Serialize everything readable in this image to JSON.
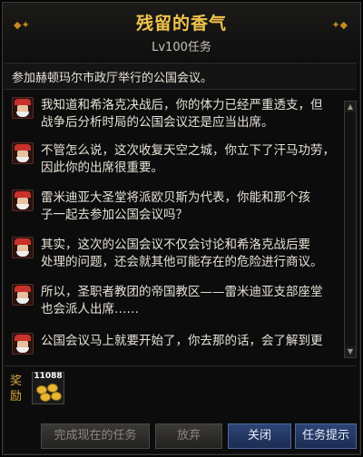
{
  "window": {
    "title": "残留的香气",
    "subtitle": "Lv100任务",
    "quest_goal": "参加赫顿玛尔市政厅举行的公国会议。"
  },
  "dialog": {
    "lines": [
      {
        "speaker_icon": "santa-npc-icon",
        "text": "我知道和希洛克决战后，你的体力已经严重透支，但\n战争后分析时局的公国会议还是应当出席。"
      },
      {
        "speaker_icon": "santa-npc-icon",
        "text": "不管怎么说，这次收复天空之城，你立下了汗马功劳，\n因此你的出席很重要。"
      },
      {
        "speaker_icon": "santa-npc-icon",
        "text": "雷米迪亚大圣堂将派欧贝斯为代表，你能和那个孩\n子一起去参加公国会议吗？"
      },
      {
        "speaker_icon": "santa-npc-icon",
        "text": "其实，这次的公国会议不仅会讨论和希洛克战后要\n处理的问题，还会就其他可能存在的危险进行商议。"
      },
      {
        "speaker_icon": "santa-npc-icon",
        "text": "所以，圣职者教团的帝国教区——雷米迪亚支部座堂\n也会派人出席……"
      },
      {
        "speaker_icon": "santa-npc-icon",
        "text": "公国会议马上就要开始了，你去那的话，会了解到更"
      }
    ]
  },
  "reward": {
    "label": "奖励",
    "item_count": "11088",
    "item_icon": "gold-coins-icon"
  },
  "buttons": {
    "complete": "完成现在的任务",
    "abandon": "放弃",
    "close": "关闭",
    "hint": "任务提示"
  },
  "colors": {
    "title": "#f2c44c",
    "active_button": "#2d4476"
  }
}
